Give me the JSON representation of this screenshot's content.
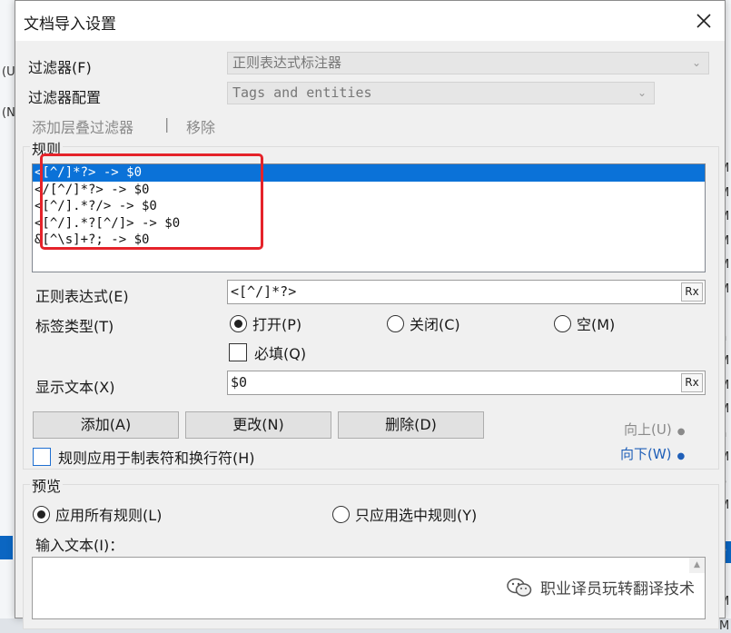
{
  "background": {
    "left_fragments": [
      "(U",
      "(N"
    ],
    "right_fragments": [
      "M",
      "M",
      "M",
      "M",
      "M",
      "M",
      "s",
      "h",
      "M",
      "M",
      "M",
      "h",
      "M",
      "o",
      "M",
      "s",
      "o",
      "e",
      "M",
      "M"
    ]
  },
  "dialog": {
    "title": "文档导入设置",
    "filter_label": "过滤器(F)",
    "filter_value": "正则表达式标注器",
    "filter_config_label": "过滤器配置",
    "filter_config_value": "Tags and entities",
    "add_cascade_filter": "添加层叠过滤器",
    "separator": "|",
    "remove": "移除",
    "rules_group_title": "规则",
    "rules": [
      "<[^/]*?> -> $0",
      "</[^/]*?> -> $0",
      "<[^/].*?/> -> $0",
      "<[^/].*?[^/]> -> $0",
      "&[^\\s]+?; -> $0"
    ],
    "selected_rule_index": 0,
    "regex_label": "正则表达式(E)",
    "regex_value": "<[^/]*?>",
    "rx_label": "Rx",
    "tag_type_label": "标签类型(T)",
    "tag_types": [
      "打开(P)",
      "关闭(C)",
      "空(M)"
    ],
    "tag_type_selected": "打开(P)",
    "required_label": "必填(Q)",
    "display_text_label": "显示文本(X)",
    "display_text_value": "$0",
    "add_button": "添加(A)",
    "change_button": "更改(N)",
    "delete_button": "删除(D)",
    "move_up": "向上(U)",
    "move_down": "向下(W)",
    "apply_tabs_label": "规则应用于制表符和换行符(H)",
    "preview_group_title": "预览",
    "apply_all_rules": "应用所有规则(L)",
    "apply_selected_rules": "只应用选中规则(Y)",
    "input_text_label": "输入文本(I)：",
    "watermark": "职业译员玩转翻译技术"
  },
  "colors": {
    "selection": "#0b72d8",
    "highlight_box": "#e5232a",
    "link_blue": "#1f5fb8"
  }
}
